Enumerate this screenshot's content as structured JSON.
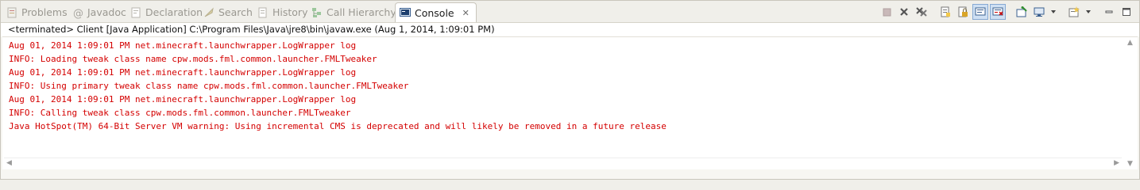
{
  "tabs": [
    {
      "label": "Problems",
      "icon": "problems-icon"
    },
    {
      "label": "Javadoc",
      "icon": "javadoc-icon"
    },
    {
      "label": "Declaration",
      "icon": "declaration-icon"
    },
    {
      "label": "Search",
      "icon": "search-icon"
    },
    {
      "label": "History",
      "icon": "history-icon"
    },
    {
      "label": "Call Hierarchy",
      "icon": "call-hierarchy-icon"
    },
    {
      "label": "Console",
      "icon": "console-icon",
      "active": true
    }
  ],
  "console": {
    "process_label": "<terminated> Client [Java Application] C:\\Program Files\\Java\\jre8\\bin\\javaw.exe (Aug 1, 2014, 1:09:01 PM)",
    "lines": [
      "Aug 01, 2014 1:09:01 PM net.minecraft.launchwrapper.LogWrapper log",
      "INFO: Loading tweak class name cpw.mods.fml.common.launcher.FMLTweaker",
      "Aug 01, 2014 1:09:01 PM net.minecraft.launchwrapper.LogWrapper log",
      "INFO: Using primary tweak class name cpw.mods.fml.common.launcher.FMLTweaker",
      "Aug 01, 2014 1:09:01 PM net.minecraft.launchwrapper.LogWrapper log",
      "INFO: Calling tweak class cpw.mods.fml.common.launcher.FMLTweaker",
      "Java HotSpot(TM) 64-Bit Server VM warning: Using incremental CMS is deprecated and will likely be removed in a future release"
    ],
    "text_color": "#d40000"
  },
  "toolbar": [
    "terminate-icon",
    "remove-launch-icon",
    "remove-all-terminated-icon",
    "clear-console-icon",
    "scroll-lock-icon",
    "show-on-stdout-icon",
    "show-on-stderr-icon",
    "pin-console-icon",
    "display-console-icon",
    "display-console-dropdown-icon",
    "open-console-icon",
    "open-console-dropdown-icon",
    "minimize-icon",
    "maximize-icon"
  ]
}
